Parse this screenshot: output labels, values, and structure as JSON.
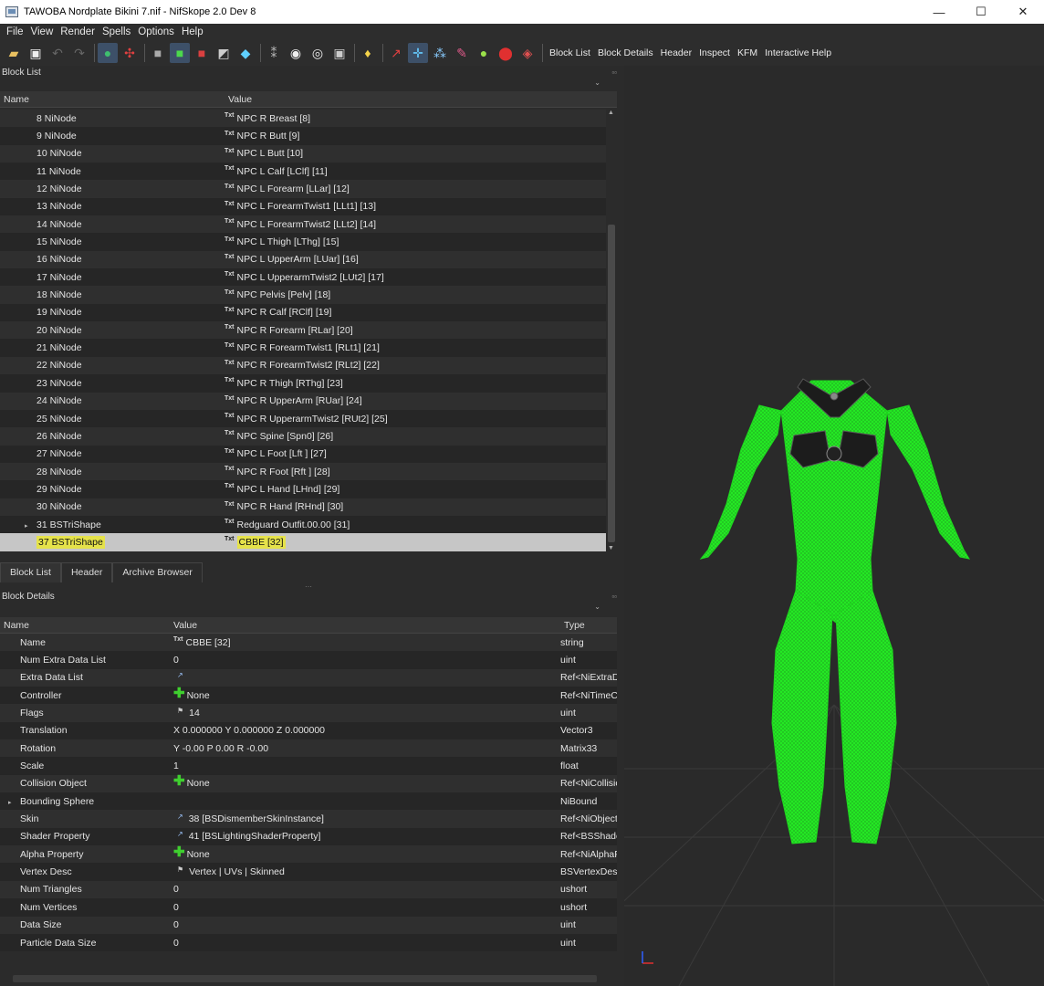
{
  "window": {
    "title": "TAWOBA Nordplate Bikini 7.nif - NifSkope 2.0 Dev 8",
    "minimize": "—",
    "maximize": "☐",
    "close": "✕"
  },
  "menu": [
    "File",
    "View",
    "Render",
    "Spells",
    "Options",
    "Help"
  ],
  "toolbar": {
    "icons": [
      "open-icon",
      "save-icon",
      "undo-icon",
      "redo-icon",
      "globe-icon",
      "spells-icon",
      "cube-gray-icon",
      "cube-green-icon",
      "cube-red-icon",
      "cube-split-icon",
      "cube-color-icon",
      "footprints-icon",
      "eye-icon",
      "eye-alt-icon",
      "camera-icon",
      "lightbulb-icon",
      "pin-icon",
      "axes-icon",
      "nodes-icon",
      "pen-icon",
      "green-ball-icon",
      "location-icon",
      "eraser-icon"
    ],
    "buttons": [
      "Block List",
      "Block Details",
      "Header",
      "Inspect",
      "KFM",
      "Interactive Help"
    ]
  },
  "block_list": {
    "title": "Block List",
    "columns": [
      "Name",
      "Value"
    ],
    "rows": [
      {
        "name": "8 NiNode",
        "value": "NPC R Breast [8]"
      },
      {
        "name": "9 NiNode",
        "value": "NPC R Butt [9]"
      },
      {
        "name": "10 NiNode",
        "value": "NPC L Butt [10]"
      },
      {
        "name": "11 NiNode",
        "value": "NPC L Calf [LClf] [11]"
      },
      {
        "name": "12 NiNode",
        "value": "NPC L Forearm [LLar] [12]"
      },
      {
        "name": "13 NiNode",
        "value": "NPC L ForearmTwist1 [LLt1] [13]"
      },
      {
        "name": "14 NiNode",
        "value": "NPC L ForearmTwist2 [LLt2] [14]"
      },
      {
        "name": "15 NiNode",
        "value": "NPC L Thigh [LThg] [15]"
      },
      {
        "name": "16 NiNode",
        "value": "NPC L UpperArm [LUar] [16]"
      },
      {
        "name": "17 NiNode",
        "value": "NPC L UpperarmTwist2 [LUt2] [17]"
      },
      {
        "name": "18 NiNode",
        "value": "NPC Pelvis [Pelv] [18]"
      },
      {
        "name": "19 NiNode",
        "value": "NPC R Calf [RClf] [19]"
      },
      {
        "name": "20 NiNode",
        "value": "NPC R Forearm [RLar] [20]"
      },
      {
        "name": "21 NiNode",
        "value": "NPC R ForearmTwist1 [RLt1] [21]"
      },
      {
        "name": "22 NiNode",
        "value": "NPC R ForearmTwist2 [RLt2] [22]"
      },
      {
        "name": "23 NiNode",
        "value": "NPC R Thigh [RThg] [23]"
      },
      {
        "name": "24 NiNode",
        "value": "NPC R UpperArm [RUar] [24]"
      },
      {
        "name": "25 NiNode",
        "value": "NPC R UpperarmTwist2 [RUt2] [25]"
      },
      {
        "name": "26 NiNode",
        "value": "NPC Spine [Spn0] [26]"
      },
      {
        "name": "27 NiNode",
        "value": "NPC L Foot [Lft ] [27]"
      },
      {
        "name": "28 NiNode",
        "value": "NPC R Foot [Rft ] [28]"
      },
      {
        "name": "29 NiNode",
        "value": "NPC L Hand [LHnd] [29]"
      },
      {
        "name": "30 NiNode",
        "value": "NPC R Hand [RHnd] [30]"
      },
      {
        "name": "31 BSTriShape",
        "value": "Redguard Outfit.00.00 [31]",
        "expandable": true
      },
      {
        "name": "37 BSTriShape",
        "value": "CBBE [32]",
        "selected": true
      }
    ],
    "txt_label": "Txt"
  },
  "tabs": [
    "Block List",
    "Header",
    "Archive Browser"
  ],
  "block_details": {
    "title": "Block Details",
    "columns": [
      "Name",
      "Value",
      "Type"
    ],
    "rows": [
      {
        "name": "Name",
        "value": "CBBE [32]",
        "type": "string",
        "icon": "txt"
      },
      {
        "name": "Num Extra Data List",
        "value": "0",
        "type": "uint"
      },
      {
        "name": "Extra Data List",
        "value": "",
        "type": "Ref<NiExtraDataList>",
        "icon": "link"
      },
      {
        "name": "Controller",
        "value": "None",
        "type": "Ref<NiTimeController>",
        "icon": "plus"
      },
      {
        "name": "Flags",
        "value": "14",
        "type": "uint",
        "icon": "flag"
      },
      {
        "name": "Translation",
        "value": "X 0.000000 Y 0.000000 Z 0.000000",
        "type": "Vector3"
      },
      {
        "name": "Rotation",
        "value": "Y -0.00 P 0.00 R -0.00",
        "type": "Matrix33"
      },
      {
        "name": "Scale",
        "value": "1",
        "type": "float"
      },
      {
        "name": "Collision Object",
        "value": "None",
        "type": "Ref<NiCollisionObject>",
        "icon": "plus"
      },
      {
        "name": "Bounding Sphere",
        "value": "",
        "type": "NiBound",
        "expandable": true
      },
      {
        "name": "Skin",
        "value": "38 [BSDismemberSkinInstance]",
        "type": "Ref<NiObject>",
        "icon": "link"
      },
      {
        "name": "Shader Property",
        "value": "41 [BSLightingShaderProperty]",
        "type": "Ref<BSShaderProperty>",
        "icon": "link"
      },
      {
        "name": "Alpha Property",
        "value": "None",
        "type": "Ref<NiAlphaProperty>",
        "icon": "plus"
      },
      {
        "name": "Vertex Desc",
        "value": "Vertex | UVs | Skinned",
        "type": "BSVertexDesc",
        "icon": "flag"
      },
      {
        "name": "Num Triangles",
        "value": "0",
        "type": "ushort"
      },
      {
        "name": "Num Vertices",
        "value": "0",
        "type": "ushort"
      },
      {
        "name": "Data Size",
        "value": "0",
        "type": "uint"
      },
      {
        "name": "Particle Data Size",
        "value": "0",
        "type": "uint"
      }
    ]
  },
  "viewport": {
    "background": "#2a2a2a",
    "mesh_color": "#22ee22",
    "mesh_dark": "#1a1a1a"
  }
}
